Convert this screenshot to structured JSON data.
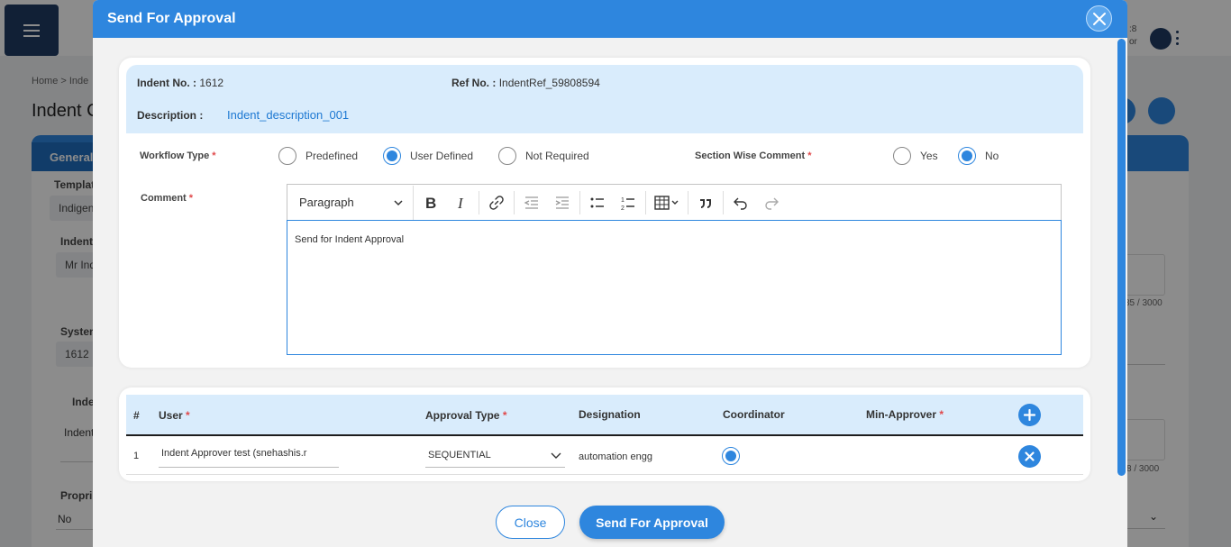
{
  "background": {
    "user_info_line1": ":8",
    "user_info_line2": "or",
    "breadcrumb": "Home >  Inde",
    "page_title": "Indent C",
    "tab_general": "General",
    "label_template": "Templat",
    "template_value": "Indigen",
    "label_indent": "Indent",
    "indent_value": "Mr Ind",
    "label_system": "System",
    "system_value": "1612",
    "label_inde": "Inde",
    "inde_value": "Indent",
    "counter_1": "85 / 3000",
    "counter_2": "8 / 3000",
    "label_proprietary": "Propri",
    "proprietary_value": "No"
  },
  "modal": {
    "title": "Send For Approval",
    "indent_no_label": "Indent No. :",
    "indent_no_value": "1612",
    "ref_no_label": "Ref No. :",
    "ref_no_value": "IndentRef_59808594",
    "description_label": "Description :",
    "description_value": "Indent_description_001",
    "workflow_type_label": "Workflow Type",
    "workflow_options": [
      "Predefined",
      "User Defined",
      "Not Required"
    ],
    "workflow_selected": "User Defined",
    "section_wise_label": "Section Wise Comment",
    "section_options": [
      "Yes",
      "No"
    ],
    "section_selected": "No",
    "comment_label": "Comment",
    "editor_paragraph": "Paragraph",
    "editor_content": "Send for Indent Approval",
    "table": {
      "headers": {
        "num": "#",
        "user": "User",
        "approval_type": "Approval Type",
        "designation": "Designation",
        "coordinator": "Coordinator",
        "min_approver": "Min-Approver"
      },
      "row": {
        "num": "1",
        "user": "Indent Approver  test (snehashis.r",
        "approval_type": "SEQUENTIAL",
        "designation": "automation engg"
      }
    },
    "close_label": "Close",
    "send_label": "Send For Approval"
  },
  "colors": {
    "primary": "#2e86de",
    "band": "#d9ecfc",
    "required": "#e0484a"
  }
}
